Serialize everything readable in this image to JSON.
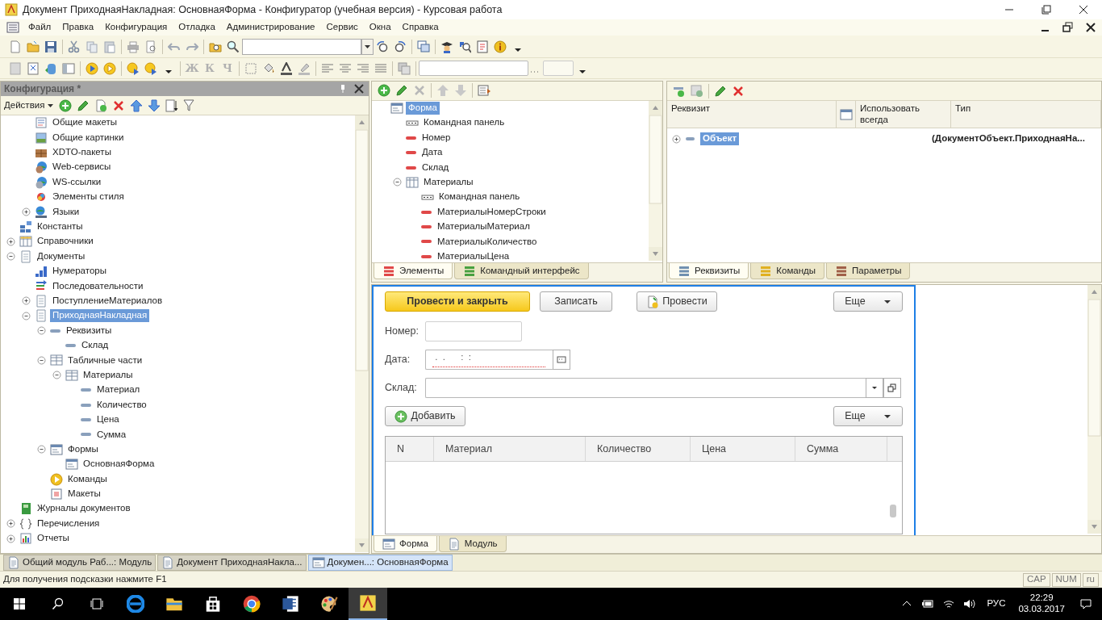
{
  "window": {
    "title": "Документ ПриходнаяНакладная: ОсновнаяФорма - Конфигуратор (учебная версия) - Курсовая работа"
  },
  "menu": [
    "Файл",
    "Правка",
    "Конфигурация",
    "Отладка",
    "Администрирование",
    "Сервис",
    "Окна",
    "Справка"
  ],
  "format_buttons": [
    {
      "label": "Ж",
      "disabled": true
    },
    {
      "label": "К",
      "disabled": true
    },
    {
      "label": "Ч",
      "disabled": true
    }
  ],
  "config_panel": {
    "title": "Конфигурация *",
    "actions": "Действия",
    "tree": [
      {
        "children": [
          {
            "kind": "layout",
            "label": "Общие макеты",
            "selected": false
          },
          {
            "kind": "picture",
            "label": "Общие картинки",
            "selected": false
          },
          {
            "kind": "xdto",
            "label": "XDTO-пакеты",
            "selected": false
          },
          {
            "kind": "webservice",
            "label": "Web-сервисы",
            "selected": false
          },
          {
            "kind": "wslink",
            "label": "WS-ссылки",
            "selected": false
          },
          {
            "kind": "style",
            "label": "Элементы стиля",
            "selected": false
          },
          {
            "kind": "language",
            "label": "Языки",
            "expanded": false,
            "selected": false
          }
        ]
      },
      {
        "kind": "constant",
        "label": "Константы",
        "selected": false
      },
      {
        "kind": "catalog",
        "label": "Справочники",
        "expanded": false,
        "selected": false
      },
      {
        "kind": "document",
        "label": "Документы",
        "expanded": true,
        "selected": false,
        "children": [
          {
            "kind": "numerator",
            "label": "Нумераторы",
            "selected": false
          },
          {
            "kind": "sequence",
            "label": "Последовательности",
            "selected": false
          },
          {
            "kind": "document",
            "label": "ПоступлениеМатериалов",
            "expanded": false,
            "selected": false
          },
          {
            "kind": "document",
            "label": "ПриходнаяНакладная",
            "expanded": true,
            "selected": true,
            "children": [
              {
                "kind": "attribute",
                "label": "Реквизиты",
                "expanded": true,
                "selected": false,
                "children": [
                  {
                    "kind": "attribute",
                    "label": "Склад",
                    "selected": false
                  }
                ]
              },
              {
                "kind": "tabular",
                "label": "Табличные части",
                "expanded": true,
                "selected": false,
                "children": [
                  {
                    "kind": "tabular",
                    "label": "Материалы",
                    "expanded": true,
                    "selected": false,
                    "children": [
                      {
                        "kind": "attribute",
                        "label": "Материал",
                        "selected": false
                      },
                      {
                        "kind": "attribute",
                        "label": "Количество",
                        "selected": false
                      },
                      {
                        "kind": "attribute",
                        "label": "Цена",
                        "selected": false
                      },
                      {
                        "kind": "attribute",
                        "label": "Сумма",
                        "selected": false
                      }
                    ]
                  }
                ]
              },
              {
                "kind": "form",
                "label": "Формы",
                "expanded": true,
                "selected": false,
                "children": [
                  {
                    "kind": "form",
                    "label": "ОсновнаяФорма",
                    "selected": false
                  }
                ]
              },
              {
                "kind": "command",
                "label": "Команды",
                "selected": false
              },
              {
                "kind": "template",
                "label": "Макеты",
                "selected": false
              }
            ]
          }
        ]
      },
      {
        "kind": "journal",
        "label": "Журналы документов",
        "selected": false
      },
      {
        "kind": "enum",
        "label": "Перечисления",
        "expanded": false,
        "selected": false
      },
      {
        "kind": "report",
        "label": "Отчеты",
        "expanded": false,
        "selected": false
      }
    ]
  },
  "elements": {
    "tree": [
      {
        "kind": "form",
        "label": "Форма",
        "selected": true,
        "children": [
          {
            "kind": "commandbar",
            "label": "Командная панель",
            "selected": false
          },
          {
            "kind": "field",
            "label": "Номер",
            "selected": false
          },
          {
            "kind": "field",
            "label": "Дата",
            "selected": false
          },
          {
            "kind": "field",
            "label": "Склад",
            "selected": false
          },
          {
            "kind": "table",
            "label": "Материалы",
            "expanded": true,
            "selected": false,
            "children": [
              {
                "kind": "commandbar",
                "label": "Командная панель",
                "selected": false
              },
              {
                "kind": "field",
                "label": "МатериалыНомерСтроки",
                "selected": false
              },
              {
                "kind": "field",
                "label": "МатериалыМатериал",
                "selected": false
              },
              {
                "kind": "field",
                "label": "МатериалыКоличество",
                "selected": false
              },
              {
                "kind": "field",
                "label": "МатериалыЦена",
                "selected": false
              }
            ]
          }
        ]
      }
    ],
    "tabs": [
      {
        "label": "Элементы",
        "color": "#e04848",
        "selected": true
      },
      {
        "label": "Командный интерфейс",
        "color": "#48a040",
        "selected": false
      }
    ]
  },
  "attributes": {
    "columns": [
      "Реквизит",
      "Использовать всегда",
      "Тип"
    ],
    "rows": [
      {
        "name": "Объект",
        "type": "(ДокументОбъект.ПриходнаяНа...",
        "expanded": false,
        "selected": true
      }
    ],
    "tabs": [
      {
        "label": "Реквизиты",
        "color": "#7090b0",
        "selected": true
      },
      {
        "label": "Команды",
        "color": "#e0b020",
        "selected": false
      },
      {
        "label": "Параметры",
        "color": "#a06048",
        "selected": false
      }
    ]
  },
  "form": {
    "buttons": [
      {
        "label": "Провести и закрыть",
        "kind": "default"
      },
      {
        "label": "Записать",
        "kind": "plain"
      },
      {
        "label": "Провести",
        "kind": "post"
      },
      {
        "label": "Еще",
        "kind": "menu"
      }
    ],
    "fields": [
      {
        "label": "Номер:",
        "kind": "text"
      },
      {
        "label": "Дата:",
        "kind": "date",
        "value": " .  .      :  :"
      },
      {
        "label": "Склад:",
        "kind": "choice"
      }
    ],
    "table_buttons": [
      {
        "label": "Добавить",
        "kind": "add"
      },
      {
        "label": "Еще",
        "kind": "menu"
      }
    ],
    "table": {
      "columns": [
        "N",
        "Материал",
        "Количество",
        "Цена",
        "Сумма"
      ]
    },
    "tabs": [
      {
        "label": "Форма",
        "kind": "form",
        "selected": true
      },
      {
        "label": "Модуль",
        "kind": "module",
        "selected": false
      }
    ]
  },
  "windows": [
    {
      "label": "Общий модуль Раб...: Модуль",
      "kind": "module",
      "selected": false
    },
    {
      "label": "Документ ПриходнаяНакла...",
      "kind": "module",
      "selected": false
    },
    {
      "label": "Докумен...: ОсновнаяФорма",
      "kind": "form",
      "selected": true
    }
  ],
  "status_bar": {
    "hint": "Для получения подсказки нажмите F1",
    "indicators": [
      "CAP",
      "NUM",
      "ru"
    ]
  },
  "taskbar": {
    "apps": [
      {
        "kind": "edge",
        "active": false
      },
      {
        "kind": "explorer",
        "active": false
      },
      {
        "kind": "store",
        "active": false
      },
      {
        "kind": "chrome",
        "active": false
      },
      {
        "kind": "word",
        "active": false
      },
      {
        "kind": "paint",
        "active": false
      },
      {
        "kind": "designer",
        "active": true
      }
    ],
    "language": "РУС",
    "time": "22:29",
    "date": "03.03.2017"
  }
}
